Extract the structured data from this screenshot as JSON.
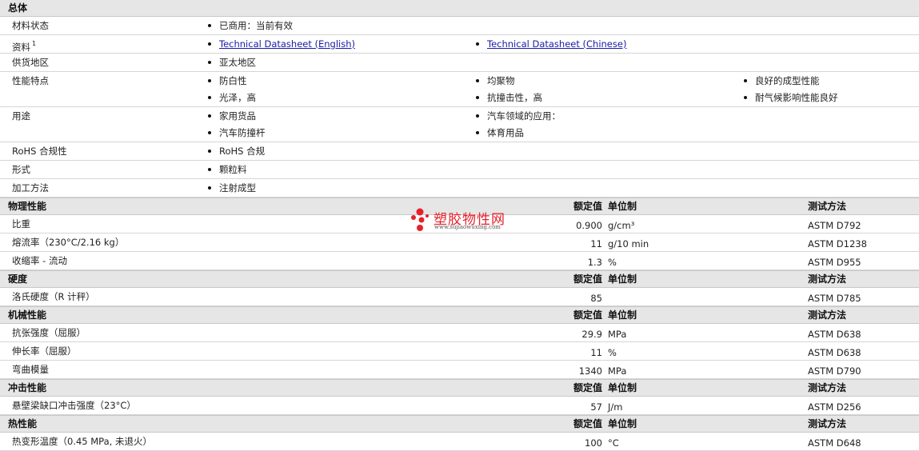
{
  "general": {
    "title": "总体",
    "material_status": {
      "label": "材料状态",
      "items": [
        "已商用：当前有效"
      ]
    },
    "documents": {
      "label": "资料",
      "footnote": "1",
      "links": [
        "Technical Datasheet (English)",
        "Technical Datasheet (Chinese)"
      ]
    },
    "supply_region": {
      "label": "供货地区",
      "items": [
        "亚太地区"
      ]
    },
    "features": {
      "label": "性能特点",
      "items": [
        "防白性",
        "均聚物",
        "良好的成型性能",
        "光泽，高",
        "抗撞击性，高",
        "耐气候影响性能良好"
      ]
    },
    "uses": {
      "label": "用途",
      "items": [
        "家用货品",
        "汽车领域的应用：",
        "汽车防撞杆",
        "体育用品"
      ]
    },
    "rohs": {
      "label": "RoHS 合规性",
      "items": [
        "RoHS 合规"
      ]
    },
    "form": {
      "label": "形式",
      "items": [
        "颗粒料"
      ]
    },
    "processing": {
      "label": "加工方法",
      "items": [
        "注射成型"
      ]
    }
  },
  "headers": {
    "value": "额定值",
    "unit": "单位制",
    "method": "测试方法"
  },
  "sections": [
    {
      "title": "物理性能",
      "rows": [
        {
          "label": "比重",
          "value": "0.900",
          "unit": "g/cm³",
          "method": "ASTM D792"
        },
        {
          "label": "熔流率（230°C/2.16 kg）",
          "value": "11",
          "unit": "g/10 min",
          "method": "ASTM D1238"
        },
        {
          "label": "收缩率 - 流动",
          "value": "1.3",
          "unit": "%",
          "method": "ASTM D955"
        }
      ]
    },
    {
      "title": "硬度",
      "rows": [
        {
          "label": "洛氏硬度（R 计秤）",
          "value": "85",
          "unit": "",
          "method": "ASTM D785"
        }
      ]
    },
    {
      "title": "机械性能",
      "rows": [
        {
          "label": "抗张强度（屈服）",
          "value": "29.9",
          "unit": "MPa",
          "method": "ASTM D638"
        },
        {
          "label": "伸长率（屈服）",
          "value": "11",
          "unit": "%",
          "method": "ASTM D638"
        },
        {
          "label": "弯曲模量",
          "value": "1340",
          "unit": "MPa",
          "method": "ASTM D790"
        }
      ]
    },
    {
      "title": "冲击性能",
      "rows": [
        {
          "label": "悬壁梁缺口冲击强度（23°C）",
          "value": "57",
          "unit": "J/m",
          "method": "ASTM D256"
        }
      ]
    },
    {
      "title": "热性能",
      "rows": [
        {
          "label": "热变形温度（0.45 MPa, 未退火）",
          "value": "100",
          "unit": "°C",
          "method": "ASTM D648"
        }
      ]
    }
  ],
  "watermark": {
    "text": "塑胶物性网",
    "url": "www.sujiaowuxing.com",
    "color": "#e8202a"
  },
  "colors": {
    "link": "#1a1aa6",
    "section_bg": "#e6e6e6"
  }
}
